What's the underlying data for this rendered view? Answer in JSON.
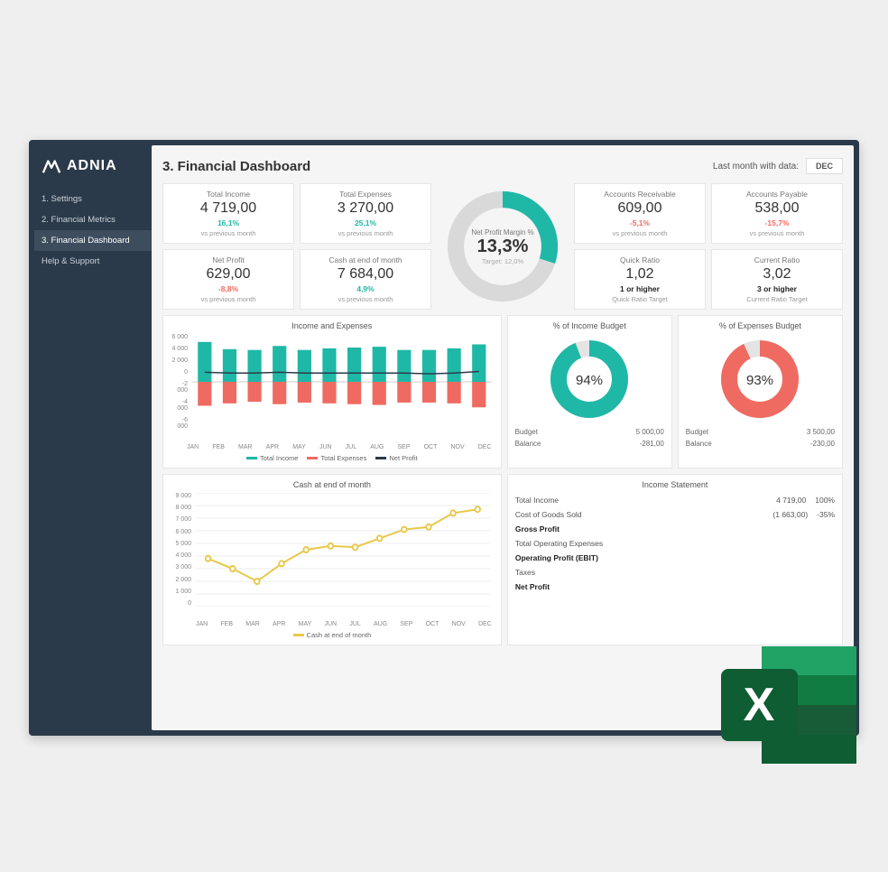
{
  "brand": "ADNIA",
  "nav": {
    "items": [
      {
        "label": "1. Settings"
      },
      {
        "label": "2. Financial Metrics"
      },
      {
        "label": "3. Financial Dashboard"
      },
      {
        "label": "Help & Support"
      }
    ],
    "active_index": 2
  },
  "header": {
    "title": "3. Financial Dashboard",
    "last_month_label": "Last month with data:",
    "month": "DEC"
  },
  "kpi": {
    "total_income": {
      "label": "Total Income",
      "value": "4 719,00",
      "delta": "16,1%",
      "delta_dir": "pos",
      "sub": "vs previous month"
    },
    "total_expenses": {
      "label": "Total Expenses",
      "value": "3 270,00",
      "delta": "25,1%",
      "delta_dir": "pos",
      "sub": "vs previous month"
    },
    "accounts_recv": {
      "label": "Accounts Receivable",
      "value": "609,00",
      "delta": "-5,1%",
      "delta_dir": "neg",
      "sub": "vs previous month"
    },
    "accounts_pay": {
      "label": "Accounts Payable",
      "value": "538,00",
      "delta": "-15,7%",
      "delta_dir": "neg",
      "sub": "vs previous month"
    },
    "net_profit": {
      "label": "Net Profit",
      "value": "629,00",
      "delta": "-8,8%",
      "delta_dir": "neg",
      "sub": "vs previous month"
    },
    "cash_eom": {
      "label": "Cash at end of month",
      "value": "7 684,00",
      "delta": "4,9%",
      "delta_dir": "pos",
      "sub": "vs previous month"
    },
    "quick_ratio": {
      "label": "Quick Ratio",
      "value": "1,02",
      "target": "1 or higher",
      "target_sub": "Quick Ratio Target",
      "color": "pos"
    },
    "current_ratio": {
      "label": "Current Ratio",
      "value": "3,02",
      "target": "3 or higher",
      "target_sub": "Current Ratio Target",
      "color": "pos"
    }
  },
  "gauge": {
    "title": "Net Profit Margin %",
    "value": "13,3%",
    "target": "Target: 12,0%",
    "pct": 30
  },
  "income_budget": {
    "title": "% of Income Budget",
    "pct_label": "94%",
    "pct": 94,
    "budget_label": "Budget",
    "budget_value": "5 000,00",
    "balance_label": "Balance",
    "balance_value": "-281,00",
    "color": "#1fb8a6"
  },
  "expenses_budget": {
    "title": "% of Expenses Budget",
    "pct_label": "93%",
    "pct": 93,
    "budget_label": "Budget",
    "budget_value": "3 500,00",
    "balance_label": "Balance",
    "balance_value": "-230,00",
    "color": "#ef6b61"
  },
  "income_statement": {
    "title": "Income Statement",
    "rows": [
      {
        "label": "Total Income",
        "value": "4 719,00",
        "pct": "100%",
        "bold": false
      },
      {
        "label": "Cost of Goods Sold",
        "value": "(1 663,00)",
        "pct": "-35%",
        "bold": false
      },
      {
        "label": "Gross Profit",
        "value": "",
        "pct": "",
        "bold": true
      },
      {
        "label": "Total Operating Expenses",
        "value": "",
        "pct": "",
        "bold": false
      },
      {
        "label": "Operating Profit (EBIT)",
        "value": "",
        "pct": "",
        "bold": true
      },
      {
        "label": "Taxes",
        "value": "",
        "pct": "",
        "bold": false
      },
      {
        "label": "Net Profit",
        "value": "",
        "pct": "",
        "bold": true
      }
    ]
  },
  "chart_data": [
    {
      "id": "income_expenses",
      "type": "bar",
      "title": "Income and Expenses",
      "categories": [
        "JAN",
        "FEB",
        "MAR",
        "APR",
        "MAY",
        "JUN",
        "JUL",
        "AUG",
        "SEP",
        "OCT",
        "NOV",
        "DEC"
      ],
      "ylim": [
        -6000,
        6000
      ],
      "yticks": [
        6000,
        4000,
        2000,
        0,
        -2000,
        -4000,
        -6000
      ],
      "series": [
        {
          "name": "Total Income",
          "color": "#1fb8a6",
          "values": [
            5000,
            4100,
            4000,
            4500,
            4000,
            4200,
            4300,
            4400,
            4000,
            4000,
            4200,
            4700
          ]
        },
        {
          "name": "Total Expenses",
          "color": "#ef6b61",
          "values": [
            -3000,
            -2700,
            -2500,
            -2800,
            -2600,
            -2700,
            -2800,
            -2900,
            -2600,
            -2600,
            -2700,
            -3200
          ]
        },
        {
          "name": "Net Profit",
          "color": "#2b3a4a",
          "type": "line",
          "values": [
            1200,
            1100,
            1100,
            1200,
            1100,
            1100,
            1100,
            1100,
            1100,
            1000,
            1100,
            1300
          ]
        }
      ]
    },
    {
      "id": "cash_eom",
      "type": "line",
      "title": "Cash at end of month",
      "categories": [
        "JAN",
        "FEB",
        "MAR",
        "APR",
        "MAY",
        "JUN",
        "JUL",
        "AUG",
        "SEP",
        "OCT",
        "NOV",
        "DEC"
      ],
      "ylim": [
        0,
        9000
      ],
      "yticks": [
        9000,
        8000,
        7000,
        6000,
        5000,
        4000,
        3000,
        2000,
        1000,
        0
      ],
      "legend": "Cash at end of month",
      "color": "#e8c84a",
      "values": [
        3800,
        3000,
        2000,
        3400,
        4500,
        4800,
        4700,
        5400,
        6100,
        6300,
        7400,
        7700
      ]
    }
  ],
  "colors": {
    "teal": "#1fb8a6",
    "red": "#ef6b61",
    "dark": "#2b3a4a",
    "yellow": "#e8c84a",
    "grey": "#d9d9d9"
  }
}
